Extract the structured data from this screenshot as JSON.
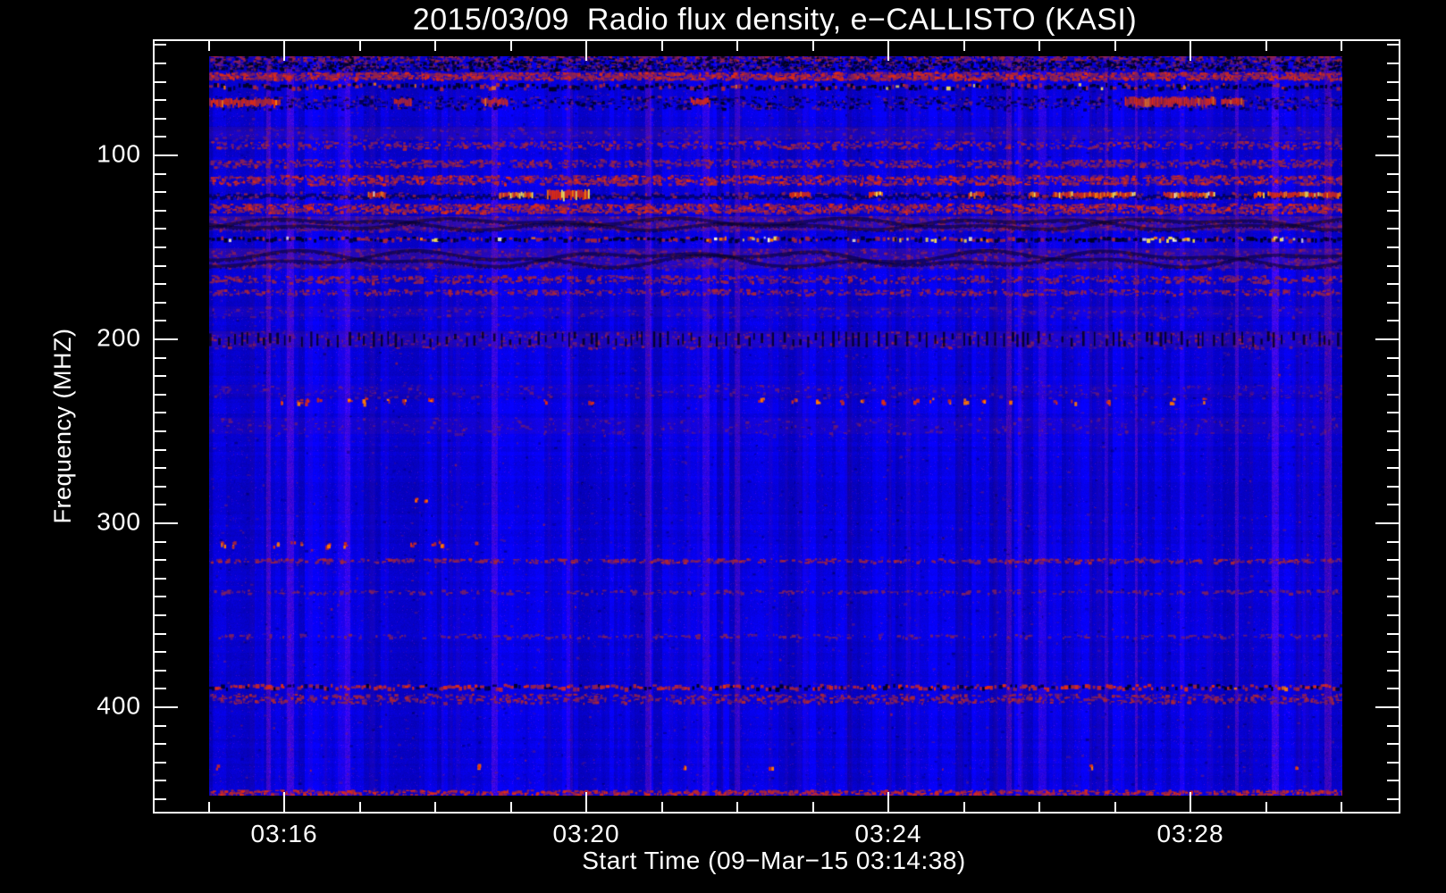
{
  "title": "2015/03/09  Radio flux density, e−CALLISTO (KASI)",
  "chart_data": {
    "type": "heatmap",
    "title": "2015/03/09  Radio flux density, e−CALLISTO (KASI)",
    "xlabel": "Start Time (09−Mar−15 03:14:38)",
    "ylabel": "Frequency (MHZ)",
    "x_ticks": [
      "03:16",
      "03:20",
      "03:24",
      "03:28"
    ],
    "x_minor_interval_min": 1,
    "x_major_interval_min": 4,
    "y_ticks": [
      100,
      200,
      300,
      400
    ],
    "y_minor_step_mhz": 10,
    "y_axis_range_mhz": [
      40,
      450
    ],
    "freq_top_mhz": 46,
    "freq_bottom_mhz": 448,
    "y_axis_inverted": true,
    "grid": false,
    "legend": "none",
    "colors": {
      "frame": "#ffffff",
      "text": "#ffffff",
      "outside": "#000000"
    },
    "palette": {
      "blue": "#1414f2",
      "dark": "#000022",
      "purple": "#7c2062",
      "crimson": "#aa2636",
      "red": "#e02c12",
      "orange": "#ff7a00",
      "yellow": "#ffe44a",
      "white_hot": "#fff6c8"
    },
    "noise_seed": 7,
    "vertical_streaks": 48,
    "bands": [
      {
        "f": 46.5,
        "w": 4,
        "style": "speckle",
        "colors": [
          "purple",
          "crimson",
          "dark"
        ],
        "density": 1.2
      },
      {
        "f": 51,
        "w": 5,
        "style": "speckle",
        "colors": [
          "dark",
          "dark",
          "purple"
        ],
        "density": 1.5
      },
      {
        "f": 56.5,
        "w": 4,
        "style": "speckle",
        "colors": [
          "crimson",
          "red",
          "purple"
        ],
        "density": 2.0
      },
      {
        "f": 62.5,
        "w": 4,
        "style": "dashline",
        "colors": [
          "dark",
          "crimson",
          "dark"
        ],
        "bright": [
          "orange",
          "yellow"
        ],
        "density": 1.6,
        "bright_chance": 0.02
      },
      {
        "f": 71,
        "w": 7,
        "style": "burstline",
        "density": 0.9,
        "segments": [
          [
            0.0,
            0.062
          ],
          [
            0.163,
            0.178
          ],
          [
            0.24,
            0.263
          ],
          [
            0.425,
            0.442
          ],
          [
            0.808,
            0.888,
            1.3
          ],
          [
            0.893,
            0.912
          ]
        ]
      },
      {
        "f": 88,
        "w": 7,
        "style": "haze",
        "color": "purple",
        "alpha": 0.16
      },
      {
        "f": 94,
        "w": 4,
        "style": "speckle",
        "colors": [
          "purple",
          "crimson"
        ],
        "density": 0.7
      },
      {
        "f": 104,
        "w": 4,
        "style": "speckle",
        "colors": [
          "purple",
          "crimson"
        ],
        "density": 0.9
      },
      {
        "f": 113,
        "w": 5,
        "style": "speckle",
        "colors": [
          "crimson",
          "purple",
          "red"
        ],
        "density": 1.5
      },
      {
        "f": 121.5,
        "w": 4,
        "style": "brightline",
        "yellow_frac": 0.2,
        "segments": [
          [
            0.14,
            0.155
          ],
          [
            0.256,
            0.285
          ],
          [
            0.298,
            0.335,
            1.6
          ],
          [
            0.512,
            0.53
          ],
          [
            0.582,
            0.594
          ],
          [
            0.67,
            0.684
          ],
          [
            0.723,
            0.732
          ],
          [
            0.745,
            0.816
          ],
          [
            0.842,
            0.887
          ],
          [
            0.922,
            0.93
          ],
          [
            0.934,
            0.998
          ]
        ]
      },
      {
        "f": 128.5,
        "w": 5,
        "style": "speckle",
        "colors": [
          "crimson",
          "red",
          "purple"
        ],
        "density": 1.8
      },
      {
        "f": 137,
        "w": 8,
        "style": "wavy",
        "alpha": 0.3
      },
      {
        "f": 145.5,
        "w": 3,
        "style": "dashline",
        "colors": [
          "dark",
          "dark",
          "crimson"
        ],
        "bright": [
          "yellow",
          "orange",
          "white_hot"
        ],
        "density": 1.9,
        "bright_chance": 0.012,
        "segments": [
          [
            0.186,
            0.205
          ],
          [
            0.438,
            0.502
          ],
          [
            0.565,
            0.69
          ],
          [
            0.822,
            0.868
          ],
          [
            0.932,
            0.957
          ]
        ]
      },
      {
        "f": 156,
        "w": 11,
        "style": "wavy",
        "alpha": 0.26
      },
      {
        "f": 167,
        "w": 4,
        "style": "speckle",
        "colors": [
          "purple",
          "crimson"
        ],
        "density": 0.8
      },
      {
        "f": 174,
        "w": 3,
        "style": "speckle",
        "colors": [
          "purple",
          "crimson"
        ],
        "density": 0.6
      },
      {
        "f": 185,
        "w": 6,
        "style": "haze",
        "color": "purple",
        "alpha": 0.1
      },
      {
        "f": 200,
        "w": 9,
        "style": "vdash",
        "alpha": 0.18,
        "density": 1.0
      },
      {
        "f": 228,
        "w": 7,
        "style": "haze",
        "color": "purple",
        "alpha": 0.07
      },
      {
        "f": 233,
        "w": 2.5,
        "style": "dots",
        "colors": [
          "red",
          "orange",
          "crimson"
        ],
        "positions": [
          0.062,
          0.078,
          0.085,
          0.096,
          0.123,
          0.136,
          0.158,
          0.17,
          0.194,
          0.296,
          0.336,
          0.486,
          0.515,
          0.537,
          0.557,
          0.575,
          0.594,
          0.622,
          0.636,
          0.651,
          0.667,
          0.681,
          0.707,
          0.745,
          0.762,
          0.793,
          0.849,
          0.876
        ]
      },
      {
        "f": 247,
        "w": 9,
        "style": "haze",
        "color": "purple",
        "alpha": 0.1
      },
      {
        "f": 287,
        "w": 2,
        "style": "dots",
        "colors": [
          "orange",
          "red"
        ],
        "positions": [
          0.182,
          0.189
        ]
      },
      {
        "f": 311,
        "w": 2.5,
        "style": "dots",
        "colors": [
          "red",
          "orange",
          "crimson"
        ],
        "positions": [
          0.012,
          0.02,
          0.058,
          0.073,
          0.08,
          0.104,
          0.118,
          0.178,
          0.196,
          0.204,
          0.233
        ]
      },
      {
        "f": 320,
        "w": 2,
        "style": "speckle",
        "colors": [
          "purple",
          "crimson"
        ],
        "density": 0.55
      },
      {
        "f": 337,
        "w": 2,
        "style": "speckle",
        "colors": [
          "purple"
        ],
        "density": 0.3
      },
      {
        "f": 361,
        "w": 2,
        "style": "speckle",
        "colors": [
          "purple"
        ],
        "density": 0.25
      },
      {
        "f": 389,
        "w": 3.5,
        "style": "dashline",
        "colors": [
          "dark",
          "crimson",
          "red"
        ],
        "bright": [
          "orange"
        ],
        "density": 1.9,
        "bright_chance": 0.005
      },
      {
        "f": 395,
        "w": 5,
        "style": "speckle",
        "colors": [
          "purple",
          "crimson"
        ],
        "density": 0.9
      },
      {
        "f": 432,
        "w": 2.5,
        "style": "dots",
        "colors": [
          "orange",
          "red"
        ],
        "positions": [
          0.005,
          0.237,
          0.419,
          0.494,
          0.778,
          0.959
        ]
      },
      {
        "f": 446,
        "w": 2.5,
        "style": "speckle",
        "colors": [
          "crimson",
          "red"
        ],
        "density": 0.8
      }
    ]
  }
}
